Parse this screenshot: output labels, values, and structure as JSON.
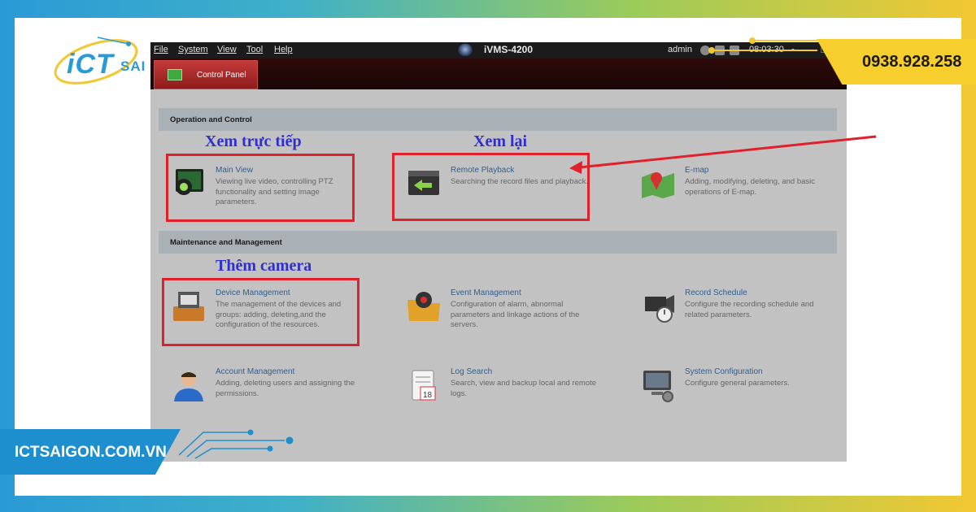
{
  "brand": {
    "logo_main": "iCT",
    "logo_sub": "SAI GON",
    "phone": "0938.928.258",
    "website": "ICTSAIGON.COM.VN"
  },
  "app": {
    "menu": [
      "File",
      "System",
      "View",
      "Tool",
      "Help"
    ],
    "title": "iVMS-4200",
    "user": "admin",
    "clock": "08:03:30",
    "tab": "Control Panel",
    "sections": [
      {
        "title": "Operation and Control",
        "items": [
          {
            "title": "Main View",
            "desc": "Viewing live video, controlling PTZ functionality and setting image parameters.",
            "icon": "main-view-icon"
          },
          {
            "title": "Remote Playback",
            "desc": "Searching the record files and playback.",
            "icon": "playback-icon"
          },
          {
            "title": "E-map",
            "desc": "Adding, modifying, deleting, and basic operations of E-map.",
            "icon": "emap-icon"
          }
        ]
      },
      {
        "title": "Maintenance and Management",
        "items": [
          {
            "title": "Device Management",
            "desc": "The management of the devices and groups: adding, deleting,and the configuration of the resources.",
            "icon": "device-management-icon"
          },
          {
            "title": "Event Management",
            "desc": "Configuration of alarm, abnormal parameters and linkage actions of the servers.",
            "icon": "event-management-icon"
          },
          {
            "title": "Record Schedule",
            "desc": "Configure the recording schedule and related parameters.",
            "icon": "record-schedule-icon"
          },
          {
            "title": "Account Management",
            "desc": "Adding, deleting users and assigning the permissions.",
            "icon": "account-icon"
          },
          {
            "title": "Log Search",
            "desc": "Search, view and backup local and remote logs.",
            "icon": "log-search-icon"
          },
          {
            "title": "System Configuration",
            "desc": "Configure general parameters.",
            "icon": "system-config-icon"
          }
        ]
      }
    ]
  },
  "annotations": {
    "live": "Xem trực tiếp",
    "playback": "Xem lại",
    "add_camera": "Thêm camera"
  },
  "colors": {
    "highlight_box": "#e0202a",
    "annotation_text": "#2f2fcf",
    "brand_blue": "#1d8fce",
    "brand_yellow": "#f6cf2e"
  }
}
